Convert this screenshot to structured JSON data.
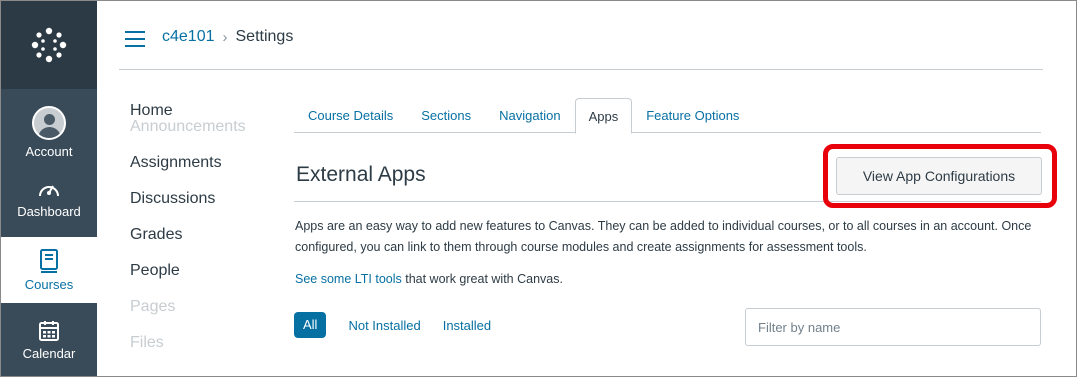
{
  "global_nav": {
    "items": [
      {
        "label": "Account",
        "icon": "user-avatar-icon"
      },
      {
        "label": "Dashboard",
        "icon": "dashboard-icon"
      },
      {
        "label": "Courses",
        "icon": "courses-book-icon"
      },
      {
        "label": "Calendar",
        "icon": "calendar-icon"
      }
    ]
  },
  "breadcrumb": {
    "course": "c4e101",
    "separator": "›",
    "current": "Settings"
  },
  "course_nav": {
    "items": [
      {
        "label": "Home"
      },
      {
        "label": "Announcements"
      },
      {
        "label": "Assignments"
      },
      {
        "label": "Discussions"
      },
      {
        "label": "Grades"
      },
      {
        "label": "People"
      },
      {
        "label": "Pages"
      },
      {
        "label": "Files"
      }
    ]
  },
  "tabs": [
    {
      "label": "Course Details"
    },
    {
      "label": "Sections"
    },
    {
      "label": "Navigation"
    },
    {
      "label": "Apps"
    },
    {
      "label": "Feature Options"
    }
  ],
  "main": {
    "title": "External Apps",
    "view_config_button": "View App Configurations",
    "description": "Apps are an easy way to add new features to Canvas. They can be added to individual courses, or to all courses in an account. Once configured, you can link to them through course modules and create assignments for assessment tools.",
    "lti_link": "See some LTI tools",
    "lti_rest": " that work great with Canvas.",
    "filters": {
      "all": "All",
      "not_installed": "Not Installed",
      "installed": "Installed"
    },
    "filter_placeholder": "Filter by name"
  },
  "colors": {
    "nav_bg": "#394b58",
    "link": "#0770a3",
    "highlight": "#e8000a"
  }
}
